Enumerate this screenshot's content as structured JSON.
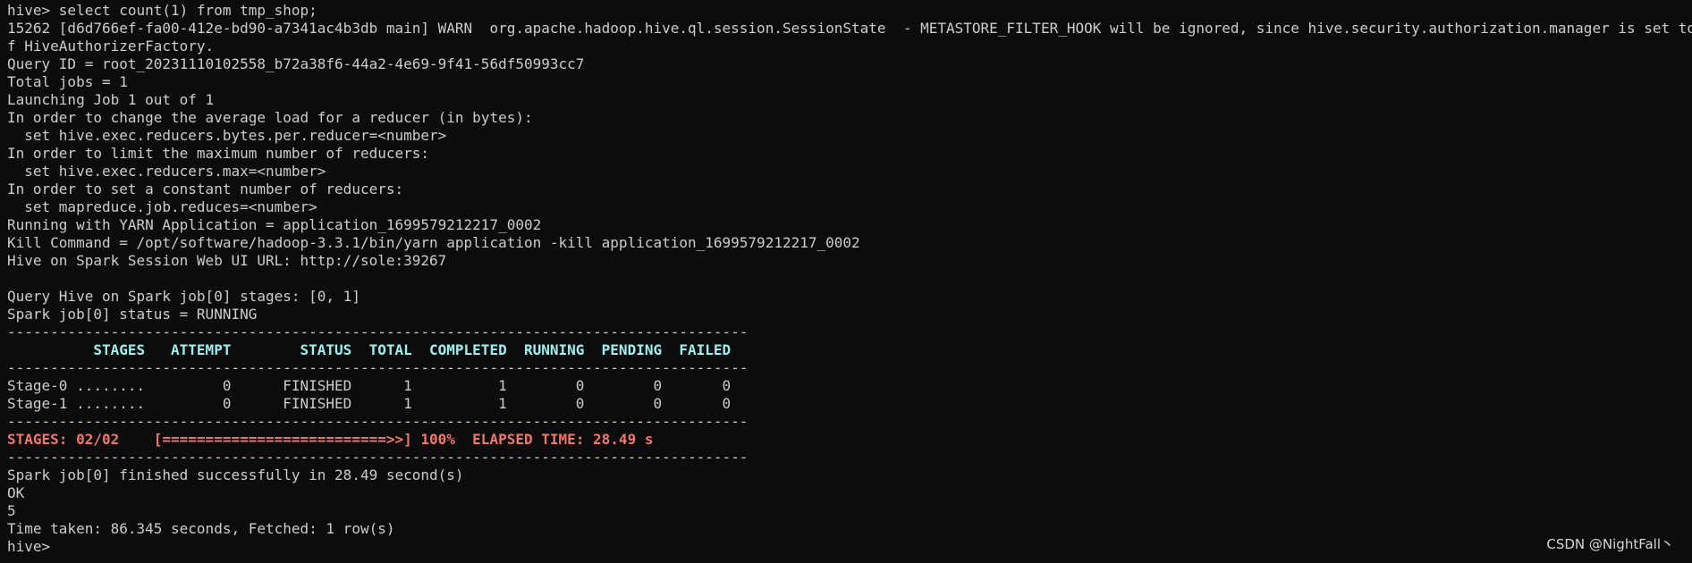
{
  "terminal": {
    "lines": [
      "hive> select count(1) from tmp_shop;",
      "15262 [d6d766ef-fa00-412e-bd90-a7341ac4b3db main] WARN  org.apache.hadoop.hive.ql.session.SessionState  - METASTORE_FILTER_HOOK will be ignored, since hive.security.authorization.manager is set to instance o",
      "f HiveAuthorizerFactory.",
      "Query ID = root_20231110102558_b72a38f6-44a2-4e69-9f41-56df50993cc7",
      "Total jobs = 1",
      "Launching Job 1 out of 1",
      "In order to change the average load for a reducer (in bytes):",
      "  set hive.exec.reducers.bytes.per.reducer=<number>",
      "In order to limit the maximum number of reducers:",
      "  set hive.exec.reducers.max=<number>",
      "In order to set a constant number of reducers:",
      "  set mapreduce.job.reduces=<number>",
      "Running with YARN Application = application_1699579212217_0002",
      "Kill Command = /opt/software/hadoop-3.3.1/bin/yarn application -kill application_1699579212217_0002",
      "Hive on Spark Session Web UI URL: http://sole:39267",
      "",
      "Query Hive on Spark job[0] stages: [0, 1]",
      "Spark job[0] status = RUNNING"
    ],
    "separator": "--------------------------------------------------------------------------------------",
    "stage_table": {
      "header": "          STAGES   ATTEMPT        STATUS  TOTAL  COMPLETED  RUNNING  PENDING  FAILED",
      "rows": [
        "Stage-0 ........         0      FINISHED      1          1        0        0       0",
        "Stage-1 ........         0      FINISHED      1          1        0        0       0"
      ],
      "progress": "STAGES: 02/02    [==========================>>] 100%  ELAPSED TIME: 28.49 s"
    },
    "result_lines": [
      "Spark job[0] finished successfully in 28.49 second(s)",
      "OK",
      "5",
      "Time taken: 86.345 seconds, Fetched: 1 row(s)"
    ],
    "final_prompt": "hive>"
  },
  "watermark": "CSDN @NightFall丶",
  "colors": {
    "background": "#0c0c0c",
    "text": "#cccccc",
    "header_cyan": "#9ef0f0",
    "progress_red": "#f1776b"
  }
}
